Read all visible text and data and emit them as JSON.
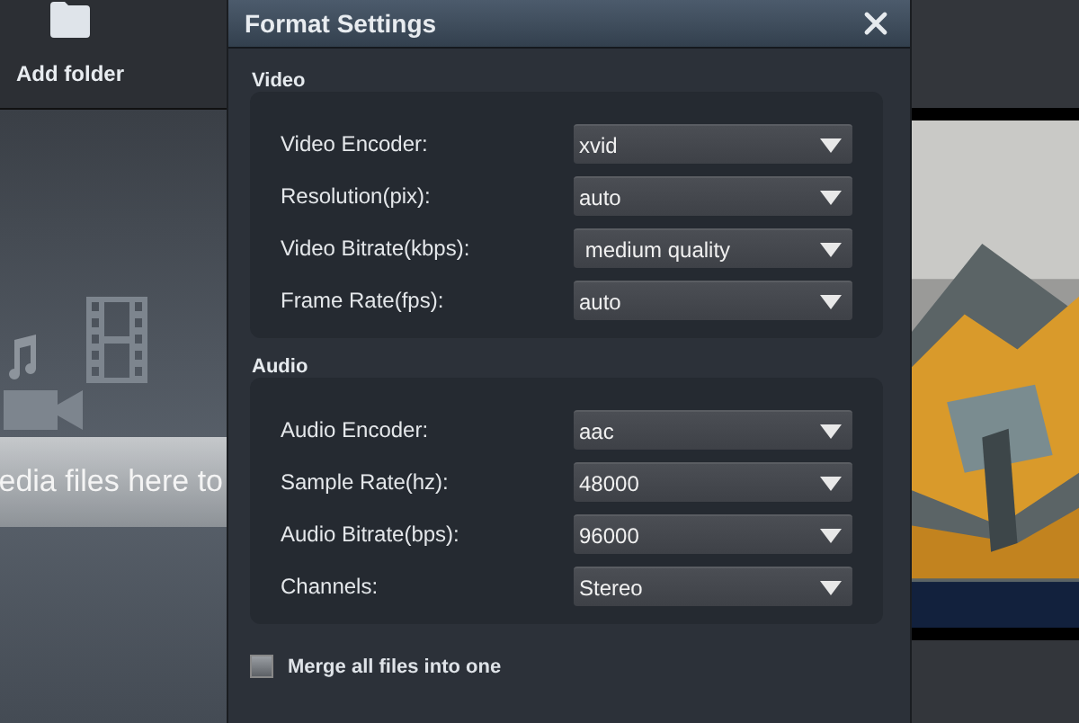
{
  "sidebar": {
    "add_folder": "Add folder",
    "drop_hint": "edia files here to"
  },
  "dialog": {
    "title": "Format Settings",
    "groups": [
      {
        "title": "Video",
        "fields": [
          {
            "label": "Video Encoder:",
            "value": "xvid"
          },
          {
            "label": "Resolution(pix):",
            "value": "auto"
          },
          {
            "label": "Video Bitrate(kbps):",
            "value": " medium quality"
          },
          {
            "label": "Frame Rate(fps):",
            "value": "auto"
          }
        ]
      },
      {
        "title": "Audio",
        "fields": [
          {
            "label": "Audio Encoder:",
            "value": "aac"
          },
          {
            "label": "Sample Rate(hz):",
            "value": "48000"
          },
          {
            "label": "Audio Bitrate(bps):",
            "value": "96000"
          },
          {
            "label": "Channels:",
            "value": "Stereo"
          }
        ]
      }
    ],
    "merge": {
      "label": "Merge all files into one",
      "checked": false
    }
  }
}
